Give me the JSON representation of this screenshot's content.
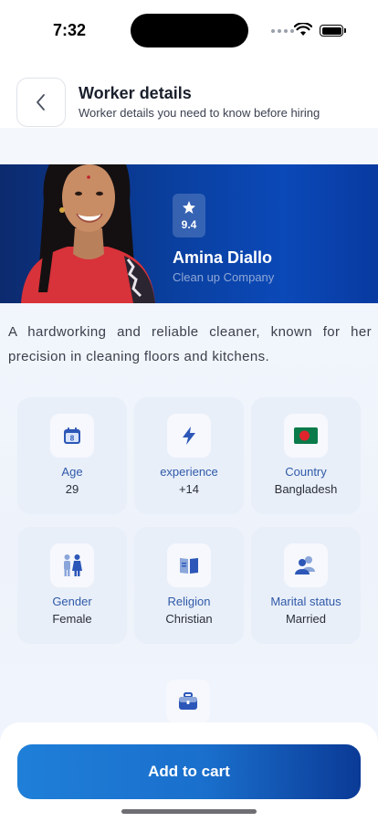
{
  "status_bar": {
    "time": "7:32"
  },
  "header": {
    "title": "Worker details",
    "subtitle": "Worker details you need to know before hiring"
  },
  "worker": {
    "rating": "9.4",
    "name": "Amina Diallo",
    "company": "Clean up Company",
    "description": "A hardworking and reliable cleaner, known for her precision in cleaning floors and kitchens."
  },
  "details": [
    {
      "label": "Age",
      "value": "29",
      "icon": "calendar-icon"
    },
    {
      "label": "experience",
      "value": "+14",
      "icon": "lightning-icon"
    },
    {
      "label": "Country",
      "value": "Bangladesh",
      "icon": "bangladesh-flag-icon"
    },
    {
      "label": "Gender",
      "value": "Female",
      "icon": "gender-icon"
    },
    {
      "label": "Religion",
      "value": "Christian",
      "icon": "book-icon"
    },
    {
      "label": "Marital status",
      "value": "Married",
      "icon": "couple-icon"
    }
  ],
  "actions": {
    "add_to_cart": "Add to cart"
  },
  "colors": {
    "banner": "#0a3f9e",
    "accent": "#2f5aa8",
    "button_start": "#1f7fd8",
    "button_end": "#0a3a96"
  }
}
